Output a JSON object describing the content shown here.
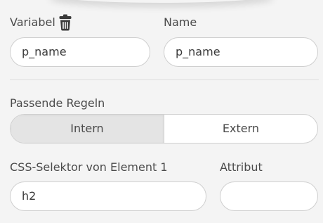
{
  "variable": {
    "label": "Variabel",
    "value": "p_name",
    "icon": "trash-icon"
  },
  "name": {
    "label": "Name",
    "value": "p_name"
  },
  "matching_rules": {
    "label": "Passende Regeln",
    "options": [
      "Intern",
      "Extern"
    ],
    "selected": "Intern"
  },
  "css_selector": {
    "label": "CSS-Selektor von Element 1",
    "value": "h2"
  },
  "attribute": {
    "label": "Attribut",
    "value": ""
  },
  "colors": {
    "background": "#f4f4f4",
    "field_border": "#cfcfcf",
    "active_segment": "#e4e4e4",
    "icon": "#3a3a3a"
  }
}
